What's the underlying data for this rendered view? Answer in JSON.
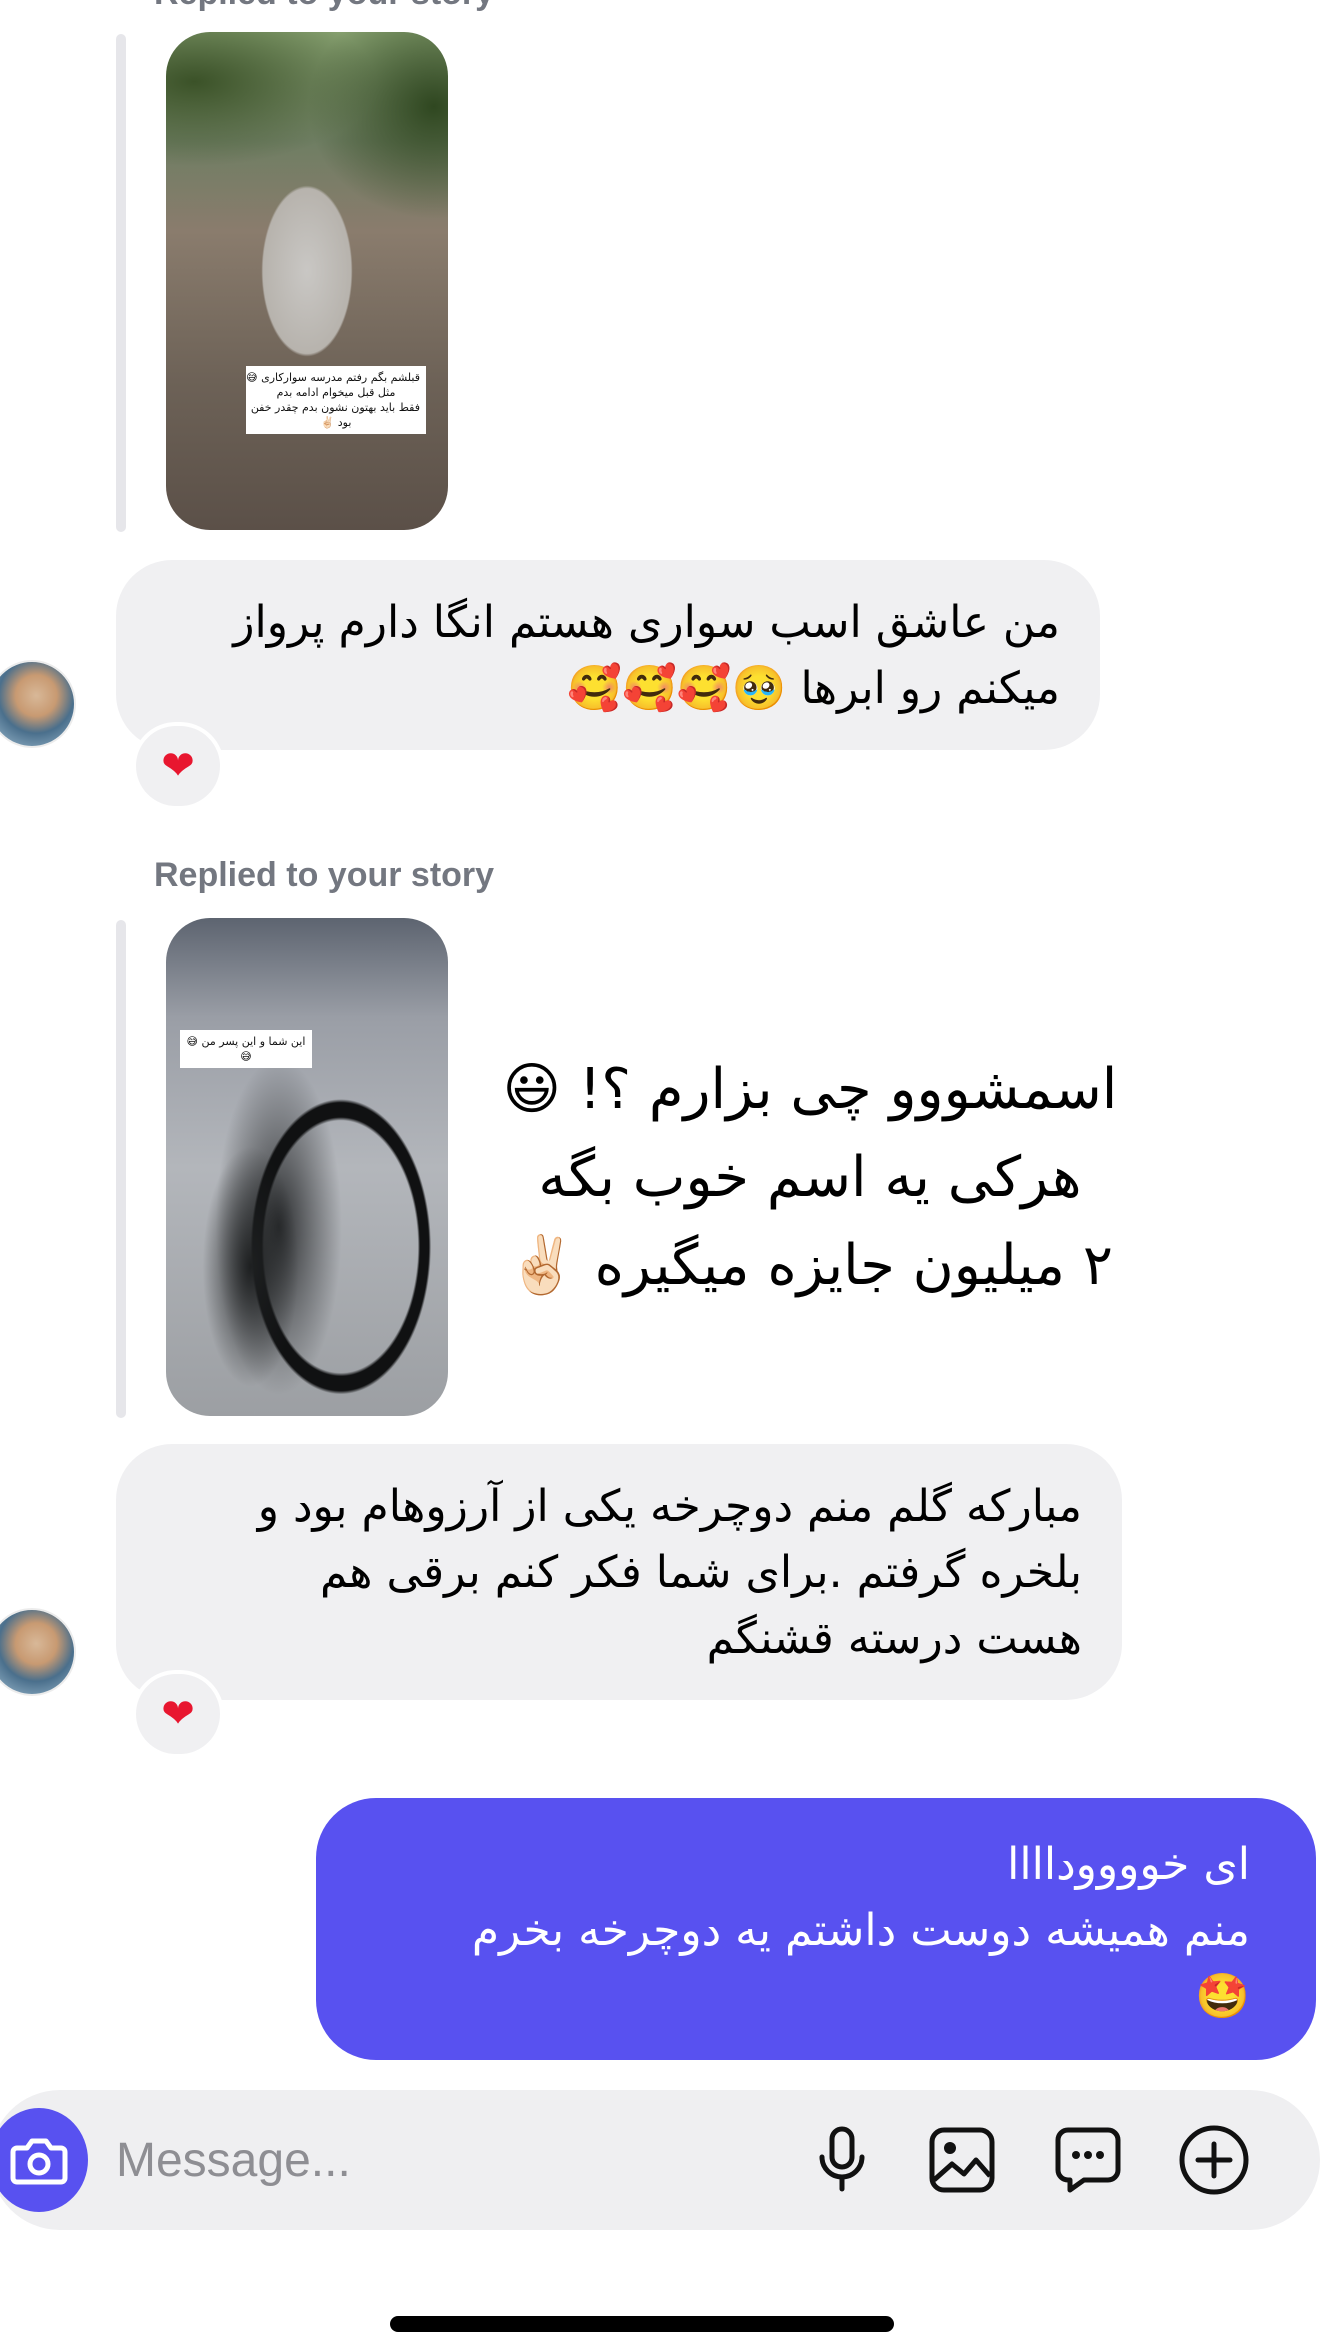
{
  "thread": {
    "story_reply_label": "Replied to your story",
    "story1": {
      "sticker_lines": [
        "قبلشم بگم رفتم مدرسه سوارکاری 😅",
        "مثل قبل میخوام ادامه بدم",
        "فقط باید بهتون نشون بدم چقدر خفن",
        "بود ✌🏻"
      ]
    },
    "message1": {
      "lines": [
        "من عاشق اسب سواری هستم انگا دارم پرواز",
        "میکنم  رو ابرها 🥹🥰🥰🥰"
      ],
      "reaction": "❤"
    },
    "story2": {
      "sticker_lines": [
        "این شما و این پسر من 😅",
        "😅"
      ],
      "caption_lines": [
        "اسمشووو چی بزارم ؟! 😃",
        "هرکی یه اسم خوب بگه",
        "۲ میلیون جایزه میگیره ✌🏻"
      ]
    },
    "message2": {
      "lines": [
        "مبارکه گلم منم دوچرخه یکی از آرزوهام بود و",
        "بلخره گرفتم .برای شما فکر کنم برقی هم",
        "هست درسته قشنگم"
      ],
      "reaction": "❤"
    },
    "reply": {
      "lines": [
        "ای خووووداااا",
        "منم همیشه دوست داشتم یه دوچرخه بخرم",
        "🤩"
      ]
    }
  },
  "composer": {
    "placeholder": "Message...",
    "icons": [
      "camera-icon",
      "microphone-icon",
      "gallery-icon",
      "sticker-icon",
      "add-icon"
    ]
  },
  "colors": {
    "accent": "#5851f0",
    "incoming_bubble": "#f0f0f2",
    "reaction_heart": "#e8162f"
  }
}
